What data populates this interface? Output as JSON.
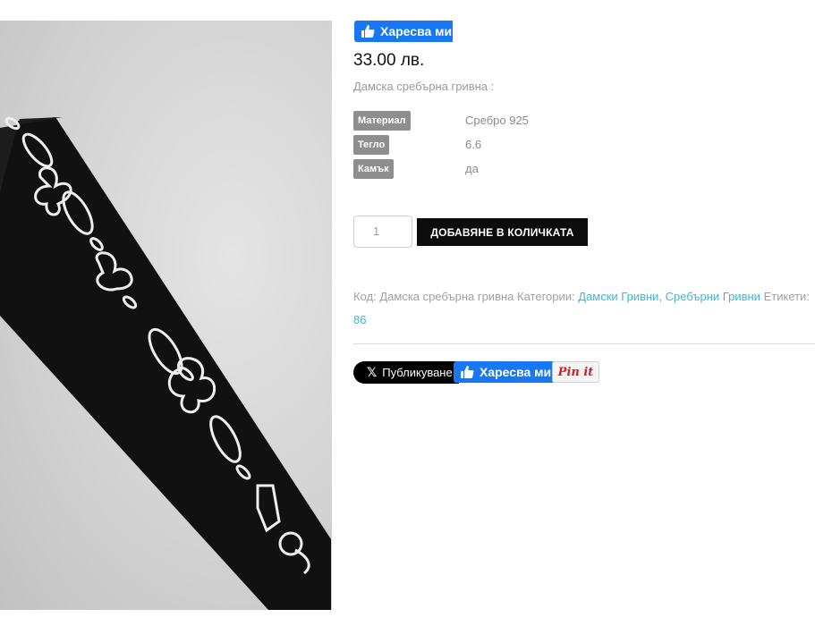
{
  "product": {
    "image_alt": "Дамска сребърна гривна",
    "fb_like_label": "Харесва ми",
    "price": "33.00 лв.",
    "short_description": "Дамска сребърна гривна  :"
  },
  "attributes": [
    {
      "label": "Материал",
      "value": "Сребро 925"
    },
    {
      "label": "Тегло",
      "value": "6.6"
    },
    {
      "label": "Камък",
      "value": "да"
    }
  ],
  "cart": {
    "quantity": "1",
    "add_button_label": "ДОБАВЯНЕ В КОЛИЧКАТА"
  },
  "meta": {
    "code_label": "Код:",
    "code_value": "Дамска сребърна гривна",
    "categories_label": "Категории:",
    "categories": [
      "Дамски Гривни",
      "Сребърни Гривни"
    ],
    "tags_label": "Етикети:",
    "tag_continuation": "86"
  },
  "share": {
    "x_label": "Публикуване",
    "fb_like_label": "Харесва ми",
    "pinterest_label": "Pin it"
  },
  "colors": {
    "facebook": "#1877f2",
    "link": "#3bb7d6",
    "pinterest": "#cb2027",
    "button": "#0c0c0c"
  }
}
